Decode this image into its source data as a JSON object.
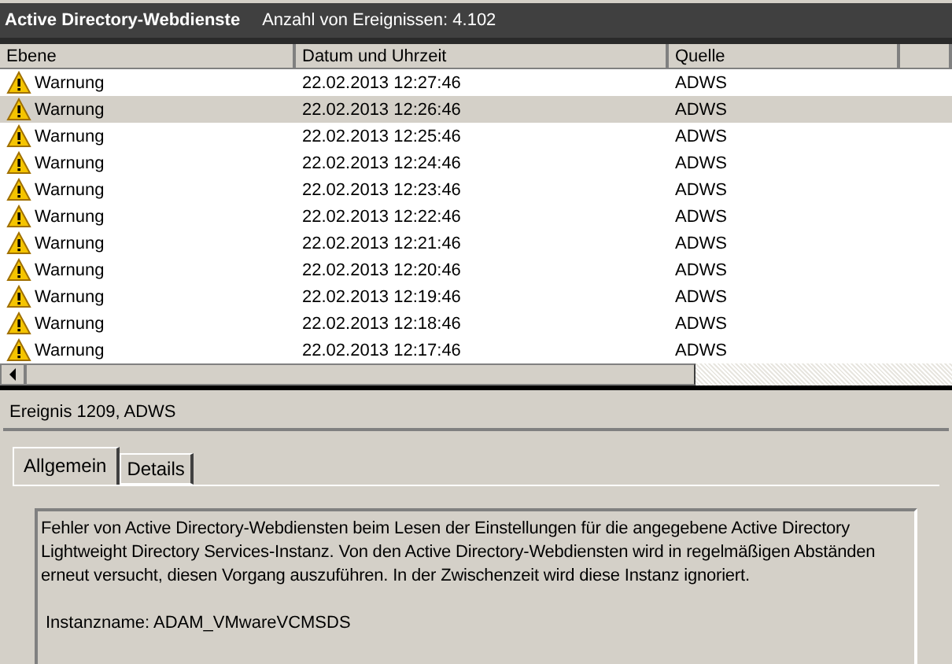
{
  "header": {
    "title": "Active Directory-Webdienste",
    "count": "Anzahl von Ereignissen: 4.102"
  },
  "table": {
    "columns": [
      "Ebene",
      "Datum und Uhrzeit",
      "Quelle"
    ],
    "rows": [
      {
        "level": "Warnung",
        "date": "22.02.2013 12:27:46",
        "source": "ADWS",
        "selected": false
      },
      {
        "level": "Warnung",
        "date": "22.02.2013 12:26:46",
        "source": "ADWS",
        "selected": true
      },
      {
        "level": "Warnung",
        "date": "22.02.2013 12:25:46",
        "source": "ADWS",
        "selected": false
      },
      {
        "level": "Warnung",
        "date": "22.02.2013 12:24:46",
        "source": "ADWS",
        "selected": false
      },
      {
        "level": "Warnung",
        "date": "22.02.2013 12:23:46",
        "source": "ADWS",
        "selected": false
      },
      {
        "level": "Warnung",
        "date": "22.02.2013 12:22:46",
        "source": "ADWS",
        "selected": false
      },
      {
        "level": "Warnung",
        "date": "22.02.2013 12:21:46",
        "source": "ADWS",
        "selected": false
      },
      {
        "level": "Warnung",
        "date": "22.02.2013 12:20:46",
        "source": "ADWS",
        "selected": false
      },
      {
        "level": "Warnung",
        "date": "22.02.2013 12:19:46",
        "source": "ADWS",
        "selected": false
      },
      {
        "level": "Warnung",
        "date": "22.02.2013 12:18:46",
        "source": "ADWS",
        "selected": false
      },
      {
        "level": "Warnung",
        "date": "22.02.2013 12:17:46",
        "source": "ADWS",
        "selected": false
      }
    ]
  },
  "detail": {
    "title": "Ereignis 1209, ADWS",
    "tabs": [
      {
        "label": "Allgemein",
        "selected": true
      },
      {
        "label": "Details",
        "selected": false
      }
    ],
    "message": "Fehler von Active Directory-Webdiensten beim Lesen der Einstellungen für die angegebene Active Directory Lightweight Directory Services-Instanz. Von den Active Directory-Webdiensten wird in regelmäßigen Abständen erneut versucht, diesen Vorgang auszuführen. In der Zwischenzeit wird diese Instanz ignoriert.",
    "instance": "Instanzname: ADAM_VMwareVCMSDS"
  }
}
